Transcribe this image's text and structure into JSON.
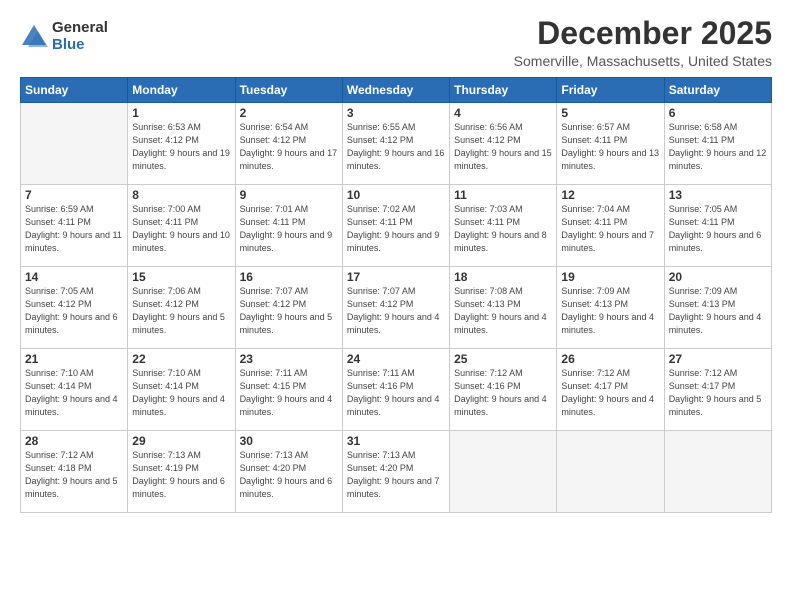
{
  "logo": {
    "general": "General",
    "blue": "Blue"
  },
  "title": "December 2025",
  "location": "Somerville, Massachusetts, United States",
  "days_header": [
    "Sunday",
    "Monday",
    "Tuesday",
    "Wednesday",
    "Thursday",
    "Friday",
    "Saturday"
  ],
  "weeks": [
    [
      {
        "day": "",
        "sunrise": "",
        "sunset": "",
        "daylight": ""
      },
      {
        "day": "1",
        "sunrise": "Sunrise: 6:53 AM",
        "sunset": "Sunset: 4:12 PM",
        "daylight": "Daylight: 9 hours and 19 minutes."
      },
      {
        "day": "2",
        "sunrise": "Sunrise: 6:54 AM",
        "sunset": "Sunset: 4:12 PM",
        "daylight": "Daylight: 9 hours and 17 minutes."
      },
      {
        "day": "3",
        "sunrise": "Sunrise: 6:55 AM",
        "sunset": "Sunset: 4:12 PM",
        "daylight": "Daylight: 9 hours and 16 minutes."
      },
      {
        "day": "4",
        "sunrise": "Sunrise: 6:56 AM",
        "sunset": "Sunset: 4:12 PM",
        "daylight": "Daylight: 9 hours and 15 minutes."
      },
      {
        "day": "5",
        "sunrise": "Sunrise: 6:57 AM",
        "sunset": "Sunset: 4:11 PM",
        "daylight": "Daylight: 9 hours and 13 minutes."
      },
      {
        "day": "6",
        "sunrise": "Sunrise: 6:58 AM",
        "sunset": "Sunset: 4:11 PM",
        "daylight": "Daylight: 9 hours and 12 minutes."
      }
    ],
    [
      {
        "day": "7",
        "sunrise": "Sunrise: 6:59 AM",
        "sunset": "Sunset: 4:11 PM",
        "daylight": "Daylight: 9 hours and 11 minutes."
      },
      {
        "day": "8",
        "sunrise": "Sunrise: 7:00 AM",
        "sunset": "Sunset: 4:11 PM",
        "daylight": "Daylight: 9 hours and 10 minutes."
      },
      {
        "day": "9",
        "sunrise": "Sunrise: 7:01 AM",
        "sunset": "Sunset: 4:11 PM",
        "daylight": "Daylight: 9 hours and 9 minutes."
      },
      {
        "day": "10",
        "sunrise": "Sunrise: 7:02 AM",
        "sunset": "Sunset: 4:11 PM",
        "daylight": "Daylight: 9 hours and 9 minutes."
      },
      {
        "day": "11",
        "sunrise": "Sunrise: 7:03 AM",
        "sunset": "Sunset: 4:11 PM",
        "daylight": "Daylight: 9 hours and 8 minutes."
      },
      {
        "day": "12",
        "sunrise": "Sunrise: 7:04 AM",
        "sunset": "Sunset: 4:11 PM",
        "daylight": "Daylight: 9 hours and 7 minutes."
      },
      {
        "day": "13",
        "sunrise": "Sunrise: 7:05 AM",
        "sunset": "Sunset: 4:11 PM",
        "daylight": "Daylight: 9 hours and 6 minutes."
      }
    ],
    [
      {
        "day": "14",
        "sunrise": "Sunrise: 7:05 AM",
        "sunset": "Sunset: 4:12 PM",
        "daylight": "Daylight: 9 hours and 6 minutes."
      },
      {
        "day": "15",
        "sunrise": "Sunrise: 7:06 AM",
        "sunset": "Sunset: 4:12 PM",
        "daylight": "Daylight: 9 hours and 5 minutes."
      },
      {
        "day": "16",
        "sunrise": "Sunrise: 7:07 AM",
        "sunset": "Sunset: 4:12 PM",
        "daylight": "Daylight: 9 hours and 5 minutes."
      },
      {
        "day": "17",
        "sunrise": "Sunrise: 7:07 AM",
        "sunset": "Sunset: 4:12 PM",
        "daylight": "Daylight: 9 hours and 4 minutes."
      },
      {
        "day": "18",
        "sunrise": "Sunrise: 7:08 AM",
        "sunset": "Sunset: 4:13 PM",
        "daylight": "Daylight: 9 hours and 4 minutes."
      },
      {
        "day": "19",
        "sunrise": "Sunrise: 7:09 AM",
        "sunset": "Sunset: 4:13 PM",
        "daylight": "Daylight: 9 hours and 4 minutes."
      },
      {
        "day": "20",
        "sunrise": "Sunrise: 7:09 AM",
        "sunset": "Sunset: 4:13 PM",
        "daylight": "Daylight: 9 hours and 4 minutes."
      }
    ],
    [
      {
        "day": "21",
        "sunrise": "Sunrise: 7:10 AM",
        "sunset": "Sunset: 4:14 PM",
        "daylight": "Daylight: 9 hours and 4 minutes."
      },
      {
        "day": "22",
        "sunrise": "Sunrise: 7:10 AM",
        "sunset": "Sunset: 4:14 PM",
        "daylight": "Daylight: 9 hours and 4 minutes."
      },
      {
        "day": "23",
        "sunrise": "Sunrise: 7:11 AM",
        "sunset": "Sunset: 4:15 PM",
        "daylight": "Daylight: 9 hours and 4 minutes."
      },
      {
        "day": "24",
        "sunrise": "Sunrise: 7:11 AM",
        "sunset": "Sunset: 4:16 PM",
        "daylight": "Daylight: 9 hours and 4 minutes."
      },
      {
        "day": "25",
        "sunrise": "Sunrise: 7:12 AM",
        "sunset": "Sunset: 4:16 PM",
        "daylight": "Daylight: 9 hours and 4 minutes."
      },
      {
        "day": "26",
        "sunrise": "Sunrise: 7:12 AM",
        "sunset": "Sunset: 4:17 PM",
        "daylight": "Daylight: 9 hours and 4 minutes."
      },
      {
        "day": "27",
        "sunrise": "Sunrise: 7:12 AM",
        "sunset": "Sunset: 4:17 PM",
        "daylight": "Daylight: 9 hours and 5 minutes."
      }
    ],
    [
      {
        "day": "28",
        "sunrise": "Sunrise: 7:12 AM",
        "sunset": "Sunset: 4:18 PM",
        "daylight": "Daylight: 9 hours and 5 minutes."
      },
      {
        "day": "29",
        "sunrise": "Sunrise: 7:13 AM",
        "sunset": "Sunset: 4:19 PM",
        "daylight": "Daylight: 9 hours and 6 minutes."
      },
      {
        "day": "30",
        "sunrise": "Sunrise: 7:13 AM",
        "sunset": "Sunset: 4:20 PM",
        "daylight": "Daylight: 9 hours and 6 minutes."
      },
      {
        "day": "31",
        "sunrise": "Sunrise: 7:13 AM",
        "sunset": "Sunset: 4:20 PM",
        "daylight": "Daylight: 9 hours and 7 minutes."
      },
      {
        "day": "",
        "sunrise": "",
        "sunset": "",
        "daylight": ""
      },
      {
        "day": "",
        "sunrise": "",
        "sunset": "",
        "daylight": ""
      },
      {
        "day": "",
        "sunrise": "",
        "sunset": "",
        "daylight": ""
      }
    ]
  ]
}
